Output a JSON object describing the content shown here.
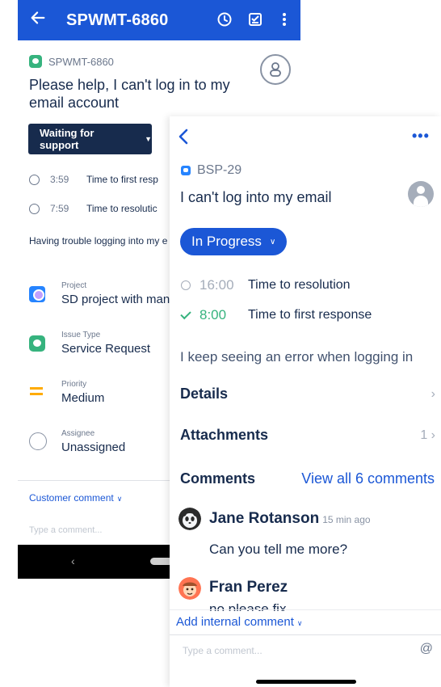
{
  "android": {
    "header": {
      "title": "SPWMT-6860",
      "back_icon": "arrow-left-icon",
      "icons": [
        "clock-icon",
        "checklist-icon",
        "more-vertical-icon"
      ]
    },
    "issue_key": "SPWMT-6860",
    "summary": "Please help, I can't log in to my email account",
    "status": "Waiting for support",
    "sla": [
      {
        "time": "3:59",
        "label": "Time to first resp"
      },
      {
        "time": "7:59",
        "label": "Time to resolutic"
      }
    ],
    "description": "Having trouble logging into my e",
    "fields": {
      "project": {
        "label": "Project",
        "value": "SD project with many"
      },
      "issue_type": {
        "label": "Issue Type",
        "value": "Service Request"
      },
      "priority": {
        "label": "Priority",
        "value": "Medium"
      },
      "assignee": {
        "label": "Assignee",
        "value": "Unassigned"
      }
    },
    "comment_mode": "Customer comment",
    "comment_placeholder": "Type a comment...",
    "nav": {
      "back": "‹"
    }
  },
  "ios": {
    "back_icon": "chevron-left-icon",
    "more_label": "•••",
    "issue_key": "BSP-29",
    "summary": "I can't log into my email",
    "status": "In Progress",
    "sla": [
      {
        "time": "16:00",
        "label": "Time to resolution",
        "color": "#a5adba",
        "icon": "clock-icon"
      },
      {
        "time": "8:00",
        "label": "Time to first response",
        "color": "#36b37e",
        "icon": "check-icon"
      }
    ],
    "description": "I keep seeing an error when logging in",
    "details": {
      "label": "Details",
      "chevron": "›"
    },
    "attachments": {
      "label": "Attachments",
      "count": "1 ›"
    },
    "comments": {
      "heading": "Comments",
      "view_all": "View all 6 comments",
      "items": [
        {
          "author": "Jane Rotanson",
          "time": "15 min ago",
          "body": "Can you tell me more?"
        },
        {
          "author": "Fran Perez",
          "time": "",
          "body": "no please fix"
        }
      ]
    },
    "internal_comment": "Add internal comment",
    "comment_placeholder": "Type a comment...",
    "mention_icon": "@"
  },
  "colors": {
    "primary": "#1b57d6",
    "navy": "#172b4d",
    "green": "#36b37e",
    "priority_medium": "#ffab00"
  }
}
